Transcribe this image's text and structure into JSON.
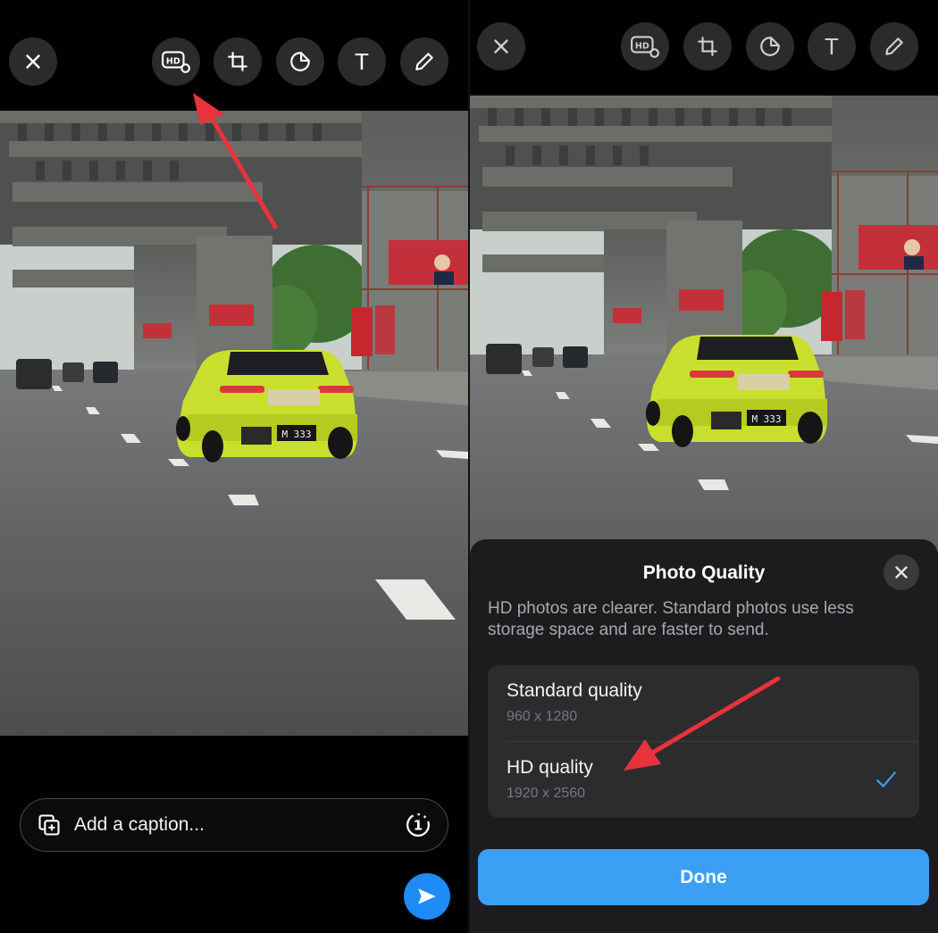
{
  "toolbar": {
    "icons": [
      "close-icon",
      "hd-quality-icon",
      "crop-rotate-icon",
      "sticker-icon",
      "text-icon",
      "draw-icon"
    ],
    "hd_badge": "HD",
    "text_glyph": "T"
  },
  "caption": {
    "placeholder": "Add a caption...",
    "view_once_label": "1"
  },
  "photo_quality_sheet": {
    "title": "Photo Quality",
    "description": "HD photos are clearer. Standard photos use less storage space and are faster to send.",
    "options": [
      {
        "label": "Standard quality",
        "resolution": "960 x 1280",
        "selected": false
      },
      {
        "label": "HD quality",
        "resolution": "1920 x 2560",
        "selected": true
      }
    ],
    "done_label": "Done"
  },
  "photo": {
    "plate_text": "M 333"
  },
  "colors": {
    "annotation_arrow": "#e8323c",
    "accent_blue": "#1d8cf8",
    "done_button": "#3b9ff3",
    "sheet_bg": "#1c1c1e",
    "car_body": "#c9df2e"
  }
}
